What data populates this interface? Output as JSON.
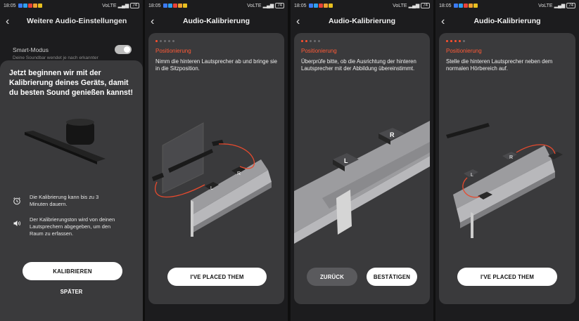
{
  "status_bar": {
    "time": "18:05",
    "network": "VoLTE",
    "battery": "74"
  },
  "screen1": {
    "header": "Weitere Audio-Einstellungen",
    "setting_label": "Smart-Modus",
    "setting_sub": "Deine Soundbar wendet je nach erkannter",
    "sheet_title": "Jetzt beginnen wir mit der Kalibrierung deines Geräts, damit du besten Sound genießen kannst!",
    "info1": "Die Kalibrierung kann bis zu 3 Minuten dauern.",
    "info2": "Der Kalibrierungston wird von deinen Lautsprechern abgegeben, um den Raum zu erfassen.",
    "primary_button": "KALIBRIEREN",
    "secondary_button": "SPÄTER"
  },
  "screen2": {
    "title": "Audio-Kalibrierung",
    "step_label": "Positionierung",
    "instruction": "Nimm die hinteren Lautsprecher ab und bringe sie in die Sitzposition.",
    "button": "I'VE PLACED THEM",
    "speaker_left": "L",
    "speaker_right": "R"
  },
  "screen3": {
    "title": "Audio-Kalibrierung",
    "step_label": "Positionierung",
    "instruction": "Überprüfe bitte, ob die Ausrichtung der hinteren Lautsprecher mit der Abbildung übereinstimmt.",
    "back_button": "ZURÜCK",
    "confirm_button": "BESTÄTIGEN",
    "speaker_left": "L",
    "speaker_right": "R"
  },
  "screen4": {
    "title": "Audio-Kalibrierung",
    "step_label": "Positionierung",
    "instruction": "Stelle die hinteren Lautsprecher neben dem normalen Hörbereich auf.",
    "button": "I'VE PLACED THEM",
    "speaker_left": "L",
    "speaker_right": "R"
  },
  "colors": {
    "accent": "#ff5a36",
    "card": "#3a3a3c",
    "background": "#1c1c1e"
  }
}
